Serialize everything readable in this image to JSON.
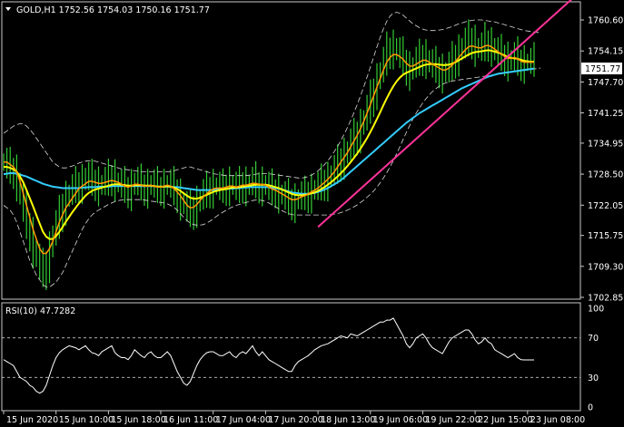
{
  "symbol_info": "GOLD,H1  1752.56 1754.03 1750.16 1751.77",
  "rsi_info": "RSI(10) 47.7282",
  "current_price_label": "1751.77",
  "colors": {
    "background": "#000000",
    "frame": "#c8c8c8",
    "candles": "#33cc33",
    "ma_fast": "#ff9900",
    "ma_slow": "#ffff00",
    "ma_long": "#33ccff",
    "bands": "#d8d8d8",
    "trendline": "#ff3399",
    "rsi_line": "#ffffff",
    "price_tag_bg": "#ffffff",
    "price_tag_text": "#000000"
  },
  "chart_data": [
    {
      "type": "line",
      "name": "price-panel",
      "y_ticks": [
        "1760.60",
        "1754.15",
        "1747.70",
        "1741.25",
        "1734.95",
        "1728.50",
        "1722.05",
        "1715.75",
        "1709.30",
        "1702.85"
      ],
      "y_tick_values": [
        1760.6,
        1754.15,
        1747.7,
        1741.25,
        1734.95,
        1728.5,
        1722.05,
        1715.75,
        1709.3,
        1702.85
      ],
      "ylim": [
        1702.85,
        1764.0
      ],
      "x_tick_labels": [
        "15 Jun 2020",
        "15 Jun 10:00",
        "15 Jun 18:00",
        "16 Jun 11:00",
        "17 Jun 04:00",
        "17 Jun 20:00",
        "18 Jun 13:00",
        "19 Jun 06:00",
        "19 Jun 22:00",
        "22 Jun 15:00",
        "23 Jun 08:00"
      ],
      "x_tick_bars": [
        0,
        16,
        32,
        48,
        64,
        80,
        96,
        112,
        128,
        144,
        160
      ],
      "bar_count": 163,
      "close": [
        1731.0,
        1730.0,
        1729.5,
        1729.0,
        1727.0,
        1724.0,
        1721.0,
        1718.0,
        1716.0,
        1713.0,
        1711.0,
        1709.0,
        1708.0,
        1710.0,
        1713.0,
        1716.0,
        1718.0,
        1720.0,
        1722.0,
        1723.5,
        1724.5,
        1725.5,
        1726.0,
        1726.5,
        1727.0,
        1728.0,
        1727.5,
        1727.0,
        1726.5,
        1726.0,
        1726.5,
        1727.0,
        1727.5,
        1728.0,
        1727.0,
        1726.5,
        1726.0,
        1725.5,
        1725.0,
        1726.0,
        1727.0,
        1726.5,
        1726.0,
        1725.5,
        1726.0,
        1726.5,
        1726.0,
        1725.5,
        1725.5,
        1726.0,
        1726.5,
        1726.0,
        1725.0,
        1724.0,
        1723.0,
        1722.0,
        1721.0,
        1720.5,
        1721.5,
        1722.5,
        1723.5,
        1724.5,
        1725.0,
        1725.5,
        1726.0,
        1726.0,
        1725.5,
        1725.5,
        1726.0,
        1726.5,
        1726.0,
        1725.5,
        1726.0,
        1726.5,
        1726.0,
        1726.5,
        1727.0,
        1726.5,
        1726.0,
        1726.5,
        1726.0,
        1725.5,
        1725.0,
        1725.0,
        1724.5,
        1724.0,
        1723.5,
        1723.0,
        1722.5,
        1723.0,
        1723.5,
        1724.0,
        1724.0,
        1724.5,
        1725.0,
        1725.5,
        1726.0,
        1726.5,
        1727.0,
        1727.5,
        1728.5,
        1729.5,
        1730.5,
        1731.5,
        1732.5,
        1733.5,
        1735.0,
        1736.0,
        1737.0,
        1738.5,
        1740.0,
        1742.0,
        1744.0,
        1746.0,
        1748.0,
        1750.0,
        1752.0,
        1754.0,
        1754.5,
        1755.0,
        1754.0,
        1753.0,
        1752.0,
        1750.5,
        1750.0,
        1751.0,
        1752.0,
        1752.5,
        1753.0,
        1752.5,
        1751.5,
        1751.0,
        1750.5,
        1750.0,
        1749.5,
        1750.0,
        1751.0,
        1752.0,
        1753.0,
        1754.0,
        1755.0,
        1756.0,
        1756.5,
        1756.0,
        1755.0,
        1754.5,
        1755.0,
        1756.0,
        1755.5,
        1755.0,
        1754.0,
        1753.5,
        1753.0,
        1752.5,
        1752.0,
        1752.5,
        1753.0,
        1752.0,
        1751.5,
        1751.77,
        1751.77,
        1751.77,
        1751.77
      ],
      "ma_fast": [
        1731.0,
        1731.0,
        1730.5,
        1730.0,
        1729.0,
        1727.0,
        1724.5,
        1722.0,
        1719.5,
        1717.0,
        1715.0,
        1713.0,
        1712.0,
        1712.0,
        1713.0,
        1714.5,
        1716.5,
        1718.5,
        1720.0,
        1721.5,
        1722.5,
        1723.5,
        1724.5,
        1725.5,
        1726.0,
        1726.5,
        1727.0,
        1727.0,
        1726.8,
        1726.6,
        1726.6,
        1726.8,
        1727.0,
        1727.2,
        1727.0,
        1726.8,
        1726.4,
        1726.0,
        1725.8,
        1726.0,
        1726.4,
        1726.4,
        1726.2,
        1726.0,
        1726.0,
        1726.2,
        1726.0,
        1725.8,
        1725.8,
        1726.0,
        1726.2,
        1726.0,
        1725.5,
        1724.8,
        1724.0,
        1723.0,
        1722.0,
        1721.5,
        1721.6,
        1722.2,
        1723.0,
        1723.8,
        1724.4,
        1725.0,
        1725.4,
        1725.6,
        1725.6,
        1725.6,
        1725.8,
        1726.0,
        1726.0,
        1725.8,
        1726.0,
        1726.2,
        1726.2,
        1726.4,
        1726.6,
        1726.6,
        1726.4,
        1726.4,
        1726.2,
        1725.8,
        1725.4,
        1725.2,
        1724.8,
        1724.4,
        1724.0,
        1723.6,
        1723.2,
        1723.2,
        1723.4,
        1723.8,
        1724.0,
        1724.4,
        1724.8,
        1725.2,
        1725.6,
        1726.2,
        1726.8,
        1727.4,
        1728.2,
        1729.0,
        1730.0,
        1731.0,
        1732.0,
        1733.0,
        1734.2,
        1735.4,
        1736.6,
        1738.0,
        1739.5,
        1741.2,
        1743.0,
        1744.8,
        1746.6,
        1748.4,
        1750.2,
        1751.8,
        1752.8,
        1753.4,
        1753.4,
        1753.0,
        1752.4,
        1751.6,
        1751.0,
        1751.0,
        1751.4,
        1751.8,
        1752.2,
        1752.2,
        1751.8,
        1751.4,
        1751.0,
        1750.6,
        1750.2,
        1750.2,
        1750.6,
        1751.2,
        1752.0,
        1752.8,
        1753.6,
        1754.4,
        1755.0,
        1755.2,
        1755.0,
        1754.8,
        1754.8,
        1755.2,
        1755.3,
        1755.0,
        1754.5,
        1754.0,
        1753.5,
        1753.0,
        1752.6,
        1752.6,
        1752.8,
        1752.5,
        1752.0,
        1751.8,
        1751.8,
        1751.8,
        1751.8
      ],
      "ma_slow": [
        1730.0,
        1730.0,
        1729.8,
        1729.5,
        1729.0,
        1728.0,
        1726.8,
        1725.2,
        1723.5,
        1721.8,
        1720.0,
        1718.2,
        1716.5,
        1715.5,
        1715.0,
        1715.0,
        1715.6,
        1716.5,
        1717.5,
        1718.6,
        1719.6,
        1720.6,
        1721.5,
        1722.4,
        1723.2,
        1724.0,
        1724.6,
        1725.0,
        1725.3,
        1725.5,
        1725.7,
        1725.9,
        1726.1,
        1726.3,
        1726.4,
        1726.4,
        1726.3,
        1726.2,
        1726.1,
        1726.1,
        1726.2,
        1726.2,
        1726.2,
        1726.1,
        1726.1,
        1726.1,
        1726.0,
        1725.9,
        1725.9,
        1725.9,
        1726.0,
        1725.9,
        1725.7,
        1725.4,
        1725.0,
        1724.5,
        1724.0,
        1723.6,
        1723.4,
        1723.4,
        1723.6,
        1723.9,
        1724.2,
        1724.5,
        1724.8,
        1725.0,
        1725.2,
        1725.3,
        1725.4,
        1725.6,
        1725.7,
        1725.7,
        1725.8,
        1725.9,
        1726.0,
        1726.1,
        1726.2,
        1726.3,
        1726.3,
        1726.3,
        1726.3,
        1726.2,
        1726.0,
        1725.8,
        1725.6,
        1725.3,
        1725.0,
        1724.7,
        1724.4,
        1724.2,
        1724.1,
        1724.1,
        1724.2,
        1724.3,
        1724.5,
        1724.7,
        1725.0,
        1725.4,
        1725.8,
        1726.3,
        1726.8,
        1727.4,
        1728.0,
        1728.7,
        1729.4,
        1730.2,
        1731.0,
        1731.9,
        1732.8,
        1733.8,
        1734.9,
        1736.0,
        1737.3,
        1738.6,
        1740.0,
        1741.4,
        1742.9,
        1744.3,
        1745.6,
        1746.8,
        1747.8,
        1748.6,
        1749.2,
        1749.6,
        1749.9,
        1750.2,
        1750.5,
        1750.8,
        1751.1,
        1751.3,
        1751.4,
        1751.4,
        1751.4,
        1751.3,
        1751.2,
        1751.2,
        1751.3,
        1751.5,
        1751.8,
        1752.2,
        1752.6,
        1753.0,
        1753.4,
        1753.7,
        1753.9,
        1754.0,
        1754.1,
        1754.2,
        1754.3,
        1754.2,
        1754.0,
        1753.8,
        1753.5,
        1753.2,
        1752.9,
        1752.7,
        1752.6,
        1752.5,
        1752.3,
        1752.1,
        1752.0,
        1751.9,
        1751.9
      ],
      "ma_long": [
        1728.5,
        1728.6,
        1728.7,
        1728.7,
        1728.6,
        1728.4,
        1728.2,
        1728.0,
        1727.7,
        1727.4,
        1727.1,
        1726.8,
        1726.5,
        1726.3,
        1726.1,
        1725.9,
        1725.8,
        1725.7,
        1725.6,
        1725.6,
        1725.6,
        1725.6,
        1725.6,
        1725.6,
        1725.7,
        1725.7,
        1725.8,
        1725.8,
        1725.8,
        1725.9,
        1725.9,
        1725.9,
        1725.9,
        1726.0,
        1726.0,
        1726.0,
        1726.0,
        1726.0,
        1726.0,
        1726.0,
        1726.0,
        1726.0,
        1726.0,
        1726.0,
        1726.0,
        1726.0,
        1726.0,
        1725.9,
        1725.9,
        1725.9,
        1725.9,
        1725.9,
        1725.8,
        1725.8,
        1725.7,
        1725.6,
        1725.5,
        1725.4,
        1725.3,
        1725.2,
        1725.2,
        1725.2,
        1725.2,
        1725.2,
        1725.2,
        1725.3,
        1725.3,
        1725.4,
        1725.4,
        1725.5,
        1725.5,
        1725.6,
        1725.6,
        1725.7,
        1725.7,
        1725.8,
        1725.8,
        1725.8,
        1725.8,
        1725.8,
        1725.8,
        1725.8,
        1725.7,
        1725.6,
        1725.5,
        1725.3,
        1725.1,
        1724.9,
        1724.7,
        1724.6,
        1724.5,
        1724.4,
        1724.4,
        1724.4,
        1724.5,
        1724.6,
        1724.8,
        1725.0,
        1725.3,
        1725.6,
        1726.0,
        1726.4,
        1726.8,
        1727.3,
        1727.8,
        1728.4,
        1729.0,
        1729.6,
        1730.2,
        1730.8,
        1731.4,
        1732.0,
        1732.6,
        1733.2,
        1733.8,
        1734.4,
        1735.0,
        1735.6,
        1736.2,
        1736.8,
        1737.4,
        1738.0,
        1738.6,
        1739.2,
        1739.7,
        1740.2,
        1740.7,
        1741.2,
        1741.6,
        1742.0,
        1742.4,
        1742.8,
        1743.2,
        1743.6,
        1744.0,
        1744.4,
        1744.8,
        1745.2,
        1745.6,
        1746.0,
        1746.4,
        1746.7,
        1747.0,
        1747.3,
        1747.6,
        1747.9,
        1748.2,
        1748.5,
        1748.8,
        1749.0,
        1749.2,
        1749.4,
        1749.5,
        1749.6,
        1749.7,
        1749.8,
        1749.9,
        1750.0,
        1750.1,
        1750.2,
        1750.3,
        1750.4,
        1750.5
      ],
      "band_upper": [
        1737.0,
        1737.5,
        1738.0,
        1738.5,
        1738.8,
        1739.0,
        1739.0,
        1738.5,
        1737.8,
        1737.0,
        1736.0,
        1735.0,
        1734.0,
        1733.0,
        1732.0,
        1731.0,
        1730.5,
        1730.0,
        1729.8,
        1729.8,
        1730.0,
        1730.2,
        1730.5,
        1730.8,
        1731.0,
        1731.2,
        1731.3,
        1731.3,
        1731.2,
        1731.0,
        1730.8,
        1730.6,
        1730.4,
        1730.2,
        1730.0,
        1729.8,
        1729.6,
        1729.5,
        1729.4,
        1729.3,
        1729.2,
        1729.1,
        1729.0,
        1729.0,
        1729.0,
        1729.0,
        1729.0,
        1729.0,
        1729.0,
        1729.0,
        1729.0,
        1729.0,
        1729.2,
        1729.4,
        1729.6,
        1729.8,
        1730.0,
        1730.0,
        1729.8,
        1729.6,
        1729.4,
        1729.2,
        1729.0,
        1728.8,
        1728.6,
        1728.5,
        1728.4,
        1728.3,
        1728.2,
        1728.2,
        1728.2,
        1728.2,
        1728.2,
        1728.2,
        1728.2,
        1728.3,
        1728.4,
        1728.5,
        1728.6,
        1728.6,
        1728.6,
        1728.6,
        1728.5,
        1728.4,
        1728.3,
        1728.2,
        1728.1,
        1728.0,
        1727.9,
        1727.8,
        1727.7,
        1727.7,
        1727.8,
        1728.0,
        1728.3,
        1728.7,
        1729.2,
        1729.8,
        1730.5,
        1731.3,
        1732.2,
        1733.2,
        1734.3,
        1735.5,
        1736.8,
        1738.2,
        1739.7,
        1741.3,
        1743.0,
        1744.8,
        1746.7,
        1748.7,
        1750.8,
        1752.9,
        1755.0,
        1757.0,
        1758.8,
        1760.3,
        1761.4,
        1762.0,
        1762.2,
        1762.0,
        1761.6,
        1761.0,
        1760.4,
        1759.8,
        1759.4,
        1759.0,
        1758.7,
        1758.5,
        1758.4,
        1758.4,
        1758.4,
        1758.5,
        1758.6,
        1758.8,
        1759.0,
        1759.2,
        1759.5,
        1759.8,
        1760.0,
        1760.2,
        1760.4,
        1760.5,
        1760.6,
        1760.6,
        1760.6,
        1760.5,
        1760.4,
        1760.3,
        1760.2,
        1760.0,
        1759.8,
        1759.6,
        1759.4,
        1759.2,
        1759.0,
        1758.8,
        1758.6,
        1758.4,
        1758.3,
        1758.2,
        1758.1,
        1758.0,
        1758.0
      ],
      "band_lower": [
        1722.0,
        1721.5,
        1721.0,
        1720.0,
        1718.5,
        1716.5,
        1714.5,
        1712.5,
        1710.5,
        1709.0,
        1707.5,
        1706.5,
        1705.5,
        1705.0,
        1705.0,
        1705.5,
        1706.0,
        1707.0,
        1708.0,
        1709.5,
        1711.0,
        1712.5,
        1714.0,
        1715.5,
        1717.0,
        1718.2,
        1719.2,
        1720.0,
        1720.6,
        1721.0,
        1721.4,
        1721.8,
        1722.2,
        1722.5,
        1722.8,
        1723.0,
        1723.1,
        1723.2,
        1723.2,
        1723.2,
        1723.2,
        1723.2,
        1723.2,
        1723.1,
        1723.0,
        1722.9,
        1722.8,
        1722.7,
        1722.6,
        1722.5,
        1722.3,
        1722.0,
        1721.6,
        1721.0,
        1720.3,
        1719.5,
        1718.8,
        1718.3,
        1718.0,
        1717.9,
        1717.9,
        1718.0,
        1718.3,
        1718.7,
        1719.2,
        1719.7,
        1720.2,
        1720.6,
        1721.0,
        1721.4,
        1721.7,
        1722.0,
        1722.2,
        1722.4,
        1722.6,
        1722.8,
        1723.0,
        1723.1,
        1723.1,
        1723.0,
        1722.8,
        1722.5,
        1722.1,
        1721.7,
        1721.3,
        1720.9,
        1720.6,
        1720.3,
        1720.1,
        1720.0,
        1720.0,
        1720.0,
        1720.0,
        1720.0,
        1720.0,
        1720.0,
        1720.0,
        1720.0,
        1720.0,
        1720.0,
        1720.1,
        1720.2,
        1720.3,
        1720.5,
        1720.7,
        1721.0,
        1721.3,
        1721.7,
        1722.1,
        1722.6,
        1723.1,
        1723.7,
        1724.3,
        1725.0,
        1725.8,
        1726.7,
        1727.7,
        1728.8,
        1730.0,
        1731.3,
        1732.7,
        1734.2,
        1735.7,
        1737.2,
        1738.6,
        1740.0,
        1741.2,
        1742.3,
        1743.3,
        1744.2,
        1745.0,
        1745.7,
        1746.3,
        1746.8,
        1747.2,
        1747.5,
        1747.7,
        1747.9,
        1748.0,
        1748.1,
        1748.2,
        1748.3,
        1748.4,
        1748.5,
        1748.6,
        1748.7,
        1748.8,
        1748.9,
        1749.0,
        1749.1,
        1749.2,
        1749.3,
        1749.4,
        1749.5,
        1749.6,
        1749.7,
        1749.8,
        1749.9,
        1750.0,
        1750.1,
        1750.2,
        1750.3,
        1750.4,
        1750.5,
        1750.6
      ],
      "trendline": {
        "from": [
          96,
          1717.5
        ],
        "to": [
          163,
          1758.5
        ]
      }
    },
    {
      "type": "line",
      "name": "rsi-panel",
      "y_ticks": [
        "100",
        "70",
        "30",
        "0"
      ],
      "y_tick_values": [
        100,
        70,
        30,
        0
      ],
      "levels": [
        70,
        30
      ],
      "ylim": [
        0,
        100
      ],
      "bar_count": 163,
      "values": [
        48,
        46,
        44,
        42,
        36,
        30,
        28,
        26,
        22,
        20,
        16,
        14,
        16,
        22,
        32,
        42,
        50,
        55,
        58,
        60,
        62,
        61,
        60,
        58,
        60,
        62,
        58,
        55,
        54,
        52,
        56,
        58,
        60,
        62,
        55,
        52,
        50,
        50,
        48,
        52,
        58,
        55,
        52,
        50,
        54,
        56,
        52,
        50,
        50,
        53,
        56,
        52,
        44,
        36,
        30,
        24,
        22,
        26,
        34,
        42,
        48,
        52,
        55,
        56,
        56,
        54,
        52,
        52,
        54,
        56,
        52,
        50,
        54,
        56,
        54,
        58,
        62,
        56,
        52,
        56,
        52,
        48,
        46,
        44,
        42,
        40,
        38,
        36,
        36,
        42,
        46,
        48,
        50,
        52,
        55,
        58,
        60,
        62,
        63,
        64,
        66,
        68,
        70,
        72,
        71,
        70,
        74,
        73,
        72,
        74,
        76,
        78,
        80,
        82,
        84,
        86,
        86,
        88,
        88,
        90,
        84,
        78,
        72,
        64,
        60,
        64,
        70,
        72,
        74,
        70,
        64,
        60,
        58,
        56,
        54,
        60,
        66,
        70,
        72,
        74,
        76,
        78,
        78,
        74,
        68,
        64,
        66,
        70,
        66,
        64,
        58,
        56,
        54,
        52,
        50,
        52,
        54,
        50,
        48,
        47.73,
        47.73,
        47.73,
        47.73
      ]
    }
  ]
}
